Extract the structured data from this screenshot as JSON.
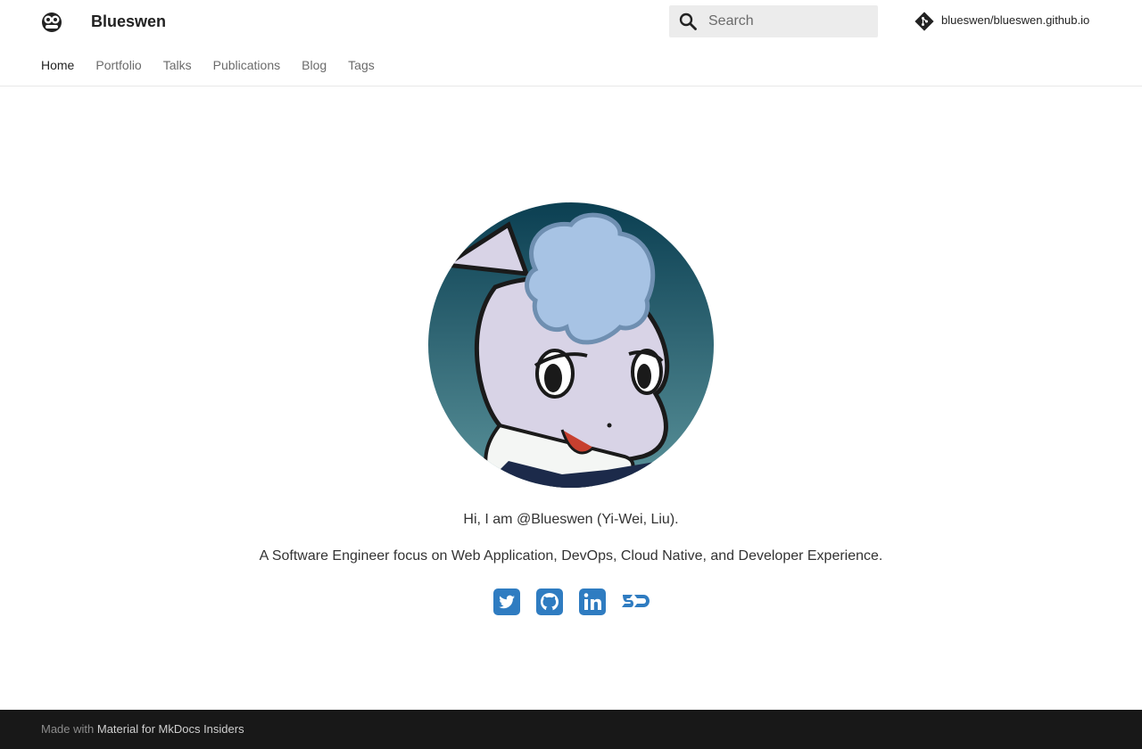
{
  "header": {
    "title": "Blueswen",
    "search_placeholder": "Search",
    "repo_name": "blueswen/blueswen.github.io"
  },
  "tabs": [
    {
      "label": "Home",
      "active": true
    },
    {
      "label": "Portfolio"
    },
    {
      "label": "Talks"
    },
    {
      "label": "Publications"
    },
    {
      "label": "Blog"
    },
    {
      "label": "Tags"
    }
  ],
  "main": {
    "intro_line1": "Hi, I am @Blueswen (Yi-Wei, Liu).",
    "intro_line2": "A Software Engineer focus on Web Application, DevOps, Cloud Native, and Developer Experience.",
    "socials": [
      "twitter-icon",
      "github-icon",
      "linkedin-icon",
      "sessionize-icon"
    ]
  },
  "footer": {
    "made_with_prefix": "Made with",
    "made_with_link": "Material for MkDocs Insiders"
  },
  "colors": {
    "social_blue": "#2f7cc1",
    "footer_bg": "#181818",
    "avatar_bg_dark": "#0d4357",
    "avatar_bg_light": "#4e8a94",
    "hair": "#a7c3e4",
    "skin": "#d8d3e6"
  }
}
